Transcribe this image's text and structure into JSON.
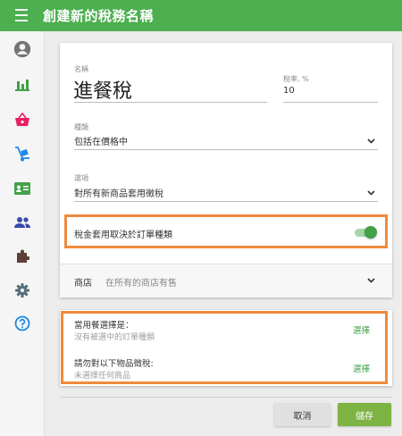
{
  "header": {
    "title": "創建新的稅務名稱"
  },
  "sidebar": {
    "items": [
      {
        "icon": "account-circle-icon",
        "color": "#757575"
      },
      {
        "icon": "bar-chart-icon",
        "color": "#43a047"
      },
      {
        "icon": "shopping-basket-icon",
        "color": "#e91e63"
      },
      {
        "icon": "hand-truck-icon",
        "color": "#1e88e5"
      },
      {
        "icon": "contact-card-icon",
        "color": "#43a047"
      },
      {
        "icon": "people-icon",
        "color": "#3949ab"
      },
      {
        "icon": "puzzle-icon",
        "color": "#5d4037"
      },
      {
        "icon": "gear-icon",
        "color": "#546e7a"
      },
      {
        "icon": "help-icon",
        "color": "#1e88e5"
      }
    ]
  },
  "form": {
    "name_label": "名稱",
    "name_value": "進餐稅",
    "rate_label": "稅率, %",
    "rate_value": "10",
    "type_label": "種類",
    "type_value": "包括在價格中",
    "option_label": "選項",
    "option_value": "對所有新商品套用徵稅",
    "toggle_label": "稅金套用取決於訂單種類",
    "toggle_on": true,
    "store_label": "商店",
    "store_value": "在所有的商店有售"
  },
  "selection": {
    "order_title": "當用餐選擇是：",
    "order_sub": "沒有被選中的訂單種類",
    "order_action": "選擇",
    "items_title": "請勿對以下物品徵稅:",
    "items_sub": "未選擇任何商品",
    "items_action": "選擇"
  },
  "buttons": {
    "cancel": "取消",
    "save": "儲存"
  },
  "colors": {
    "accent": "#4caf50",
    "highlight": "#ef8a3d",
    "save": "#7cb342"
  }
}
